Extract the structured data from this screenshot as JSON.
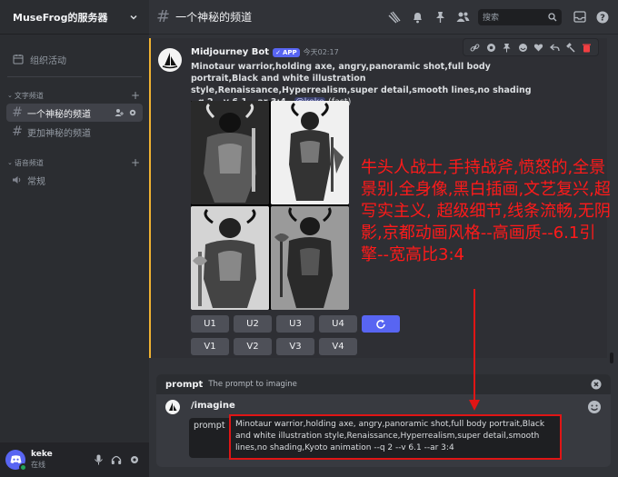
{
  "server": {
    "name": "MuseFrog的服务器"
  },
  "sidebar": {
    "events_label": "组织活动",
    "text_category": "文字频道",
    "voice_category": "语音频道",
    "channels": [
      {
        "name": "一个神秘的频道",
        "active": true
      },
      {
        "name": "更加神秘的频道",
        "active": false
      }
    ],
    "voice_channels": [
      {
        "name": "常规"
      }
    ]
  },
  "user": {
    "name": "keke",
    "status": "在线"
  },
  "topbar": {
    "channel_name": "一个神秘的频道",
    "search_placeholder": "搜索"
  },
  "message": {
    "author": "Midjourney Bot",
    "badge": "APP",
    "time": "今天02:17",
    "prompt_text": "Minotaur warrior,holding axe, angry,panoramic shot,full body portrait,Black and white illustration style,Renaissance,Hyperrealism,super detail,smooth lines,no shading --q 2 --v 6.1 --ar 3:4",
    "separator": " - ",
    "mention": "@keke",
    "mode": "(fast)",
    "upscale_buttons": [
      "U1",
      "U2",
      "U3",
      "U4"
    ],
    "variation_buttons": [
      "V1",
      "V2",
      "V3",
      "V4"
    ]
  },
  "annotation": "牛头人战士,手持战斧,愤怒的,全景景别,全身像,黑白插画,文艺复兴,超写实主义, 超级细节,线条流畅,无阴影,京都动画风格--高画质--6.1引擎--宽高比3:4",
  "composer": {
    "hint_name": "prompt",
    "hint_desc": "The prompt to imagine",
    "command": "/imagine",
    "option_label": "prompt",
    "option_value": "Minotaur warrior,holding axe, angry,panoramic shot,full body portrait,Black and white illustration style,Renaissance,Hyperrealism,super detail,smooth lines,no shading,Kyoto animation --q 2 --v 6.1 --ar 3:4"
  },
  "colors": {
    "accent": "#5865f2",
    "highlight": "#f0b232",
    "annotation": "#ff1a1a",
    "online": "#23a55a"
  }
}
